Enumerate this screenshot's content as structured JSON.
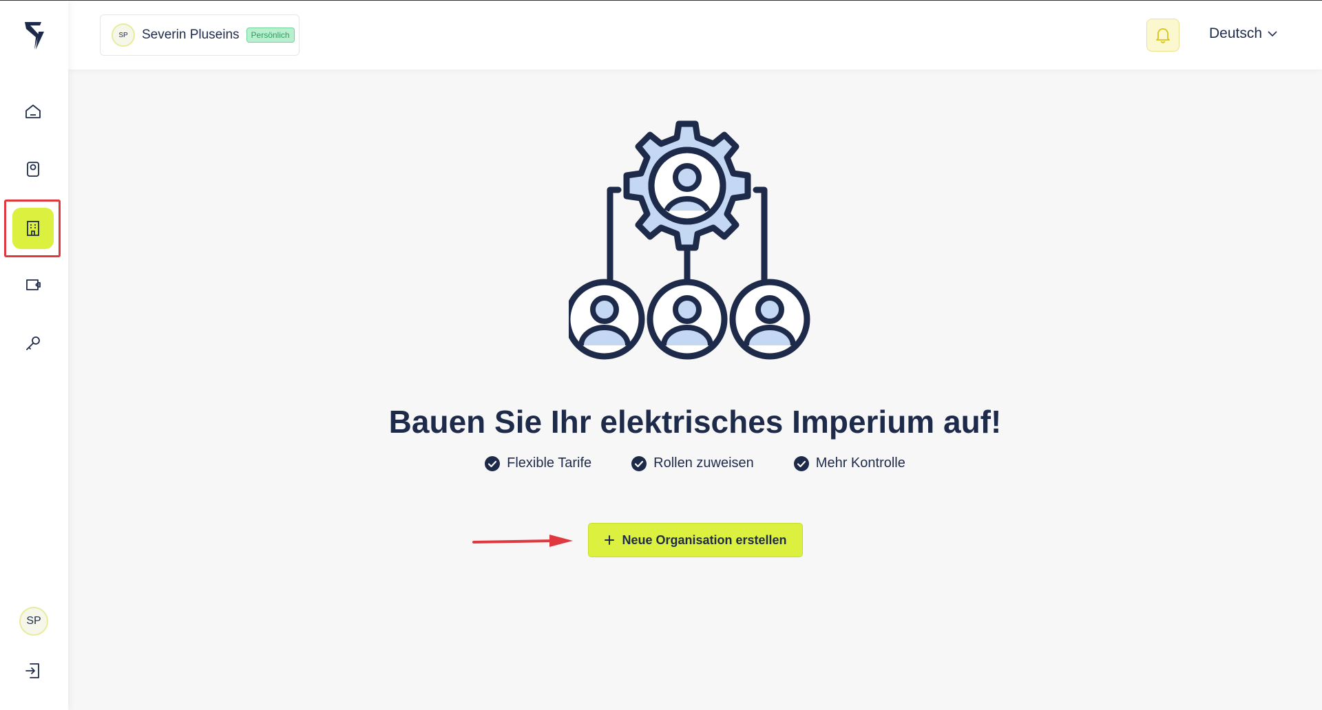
{
  "header": {
    "account": {
      "initials": "SP",
      "name": "Severin Pluseins",
      "badge": "Persönlich"
    },
    "language": "Deutsch"
  },
  "sidebar": {
    "items": [
      {
        "icon": "home-icon"
      },
      {
        "icon": "charger-icon"
      },
      {
        "icon": "building-icon",
        "active": true
      },
      {
        "icon": "wallet-icon"
      },
      {
        "icon": "key-icon"
      }
    ],
    "avatar_initials": "SP"
  },
  "main": {
    "headline": "Bauen Sie Ihr elektrisches Imperium auf!",
    "features": [
      "Flexible Tarife",
      "Rollen zuweisen",
      "Mehr Kontrolle"
    ],
    "cta_label": "Neue Organisation erstellen"
  },
  "colors": {
    "accent": "#dcf03f",
    "text": "#1e2a4a",
    "highlight": "#e0383e",
    "badge_bg": "#b8f0cf"
  }
}
